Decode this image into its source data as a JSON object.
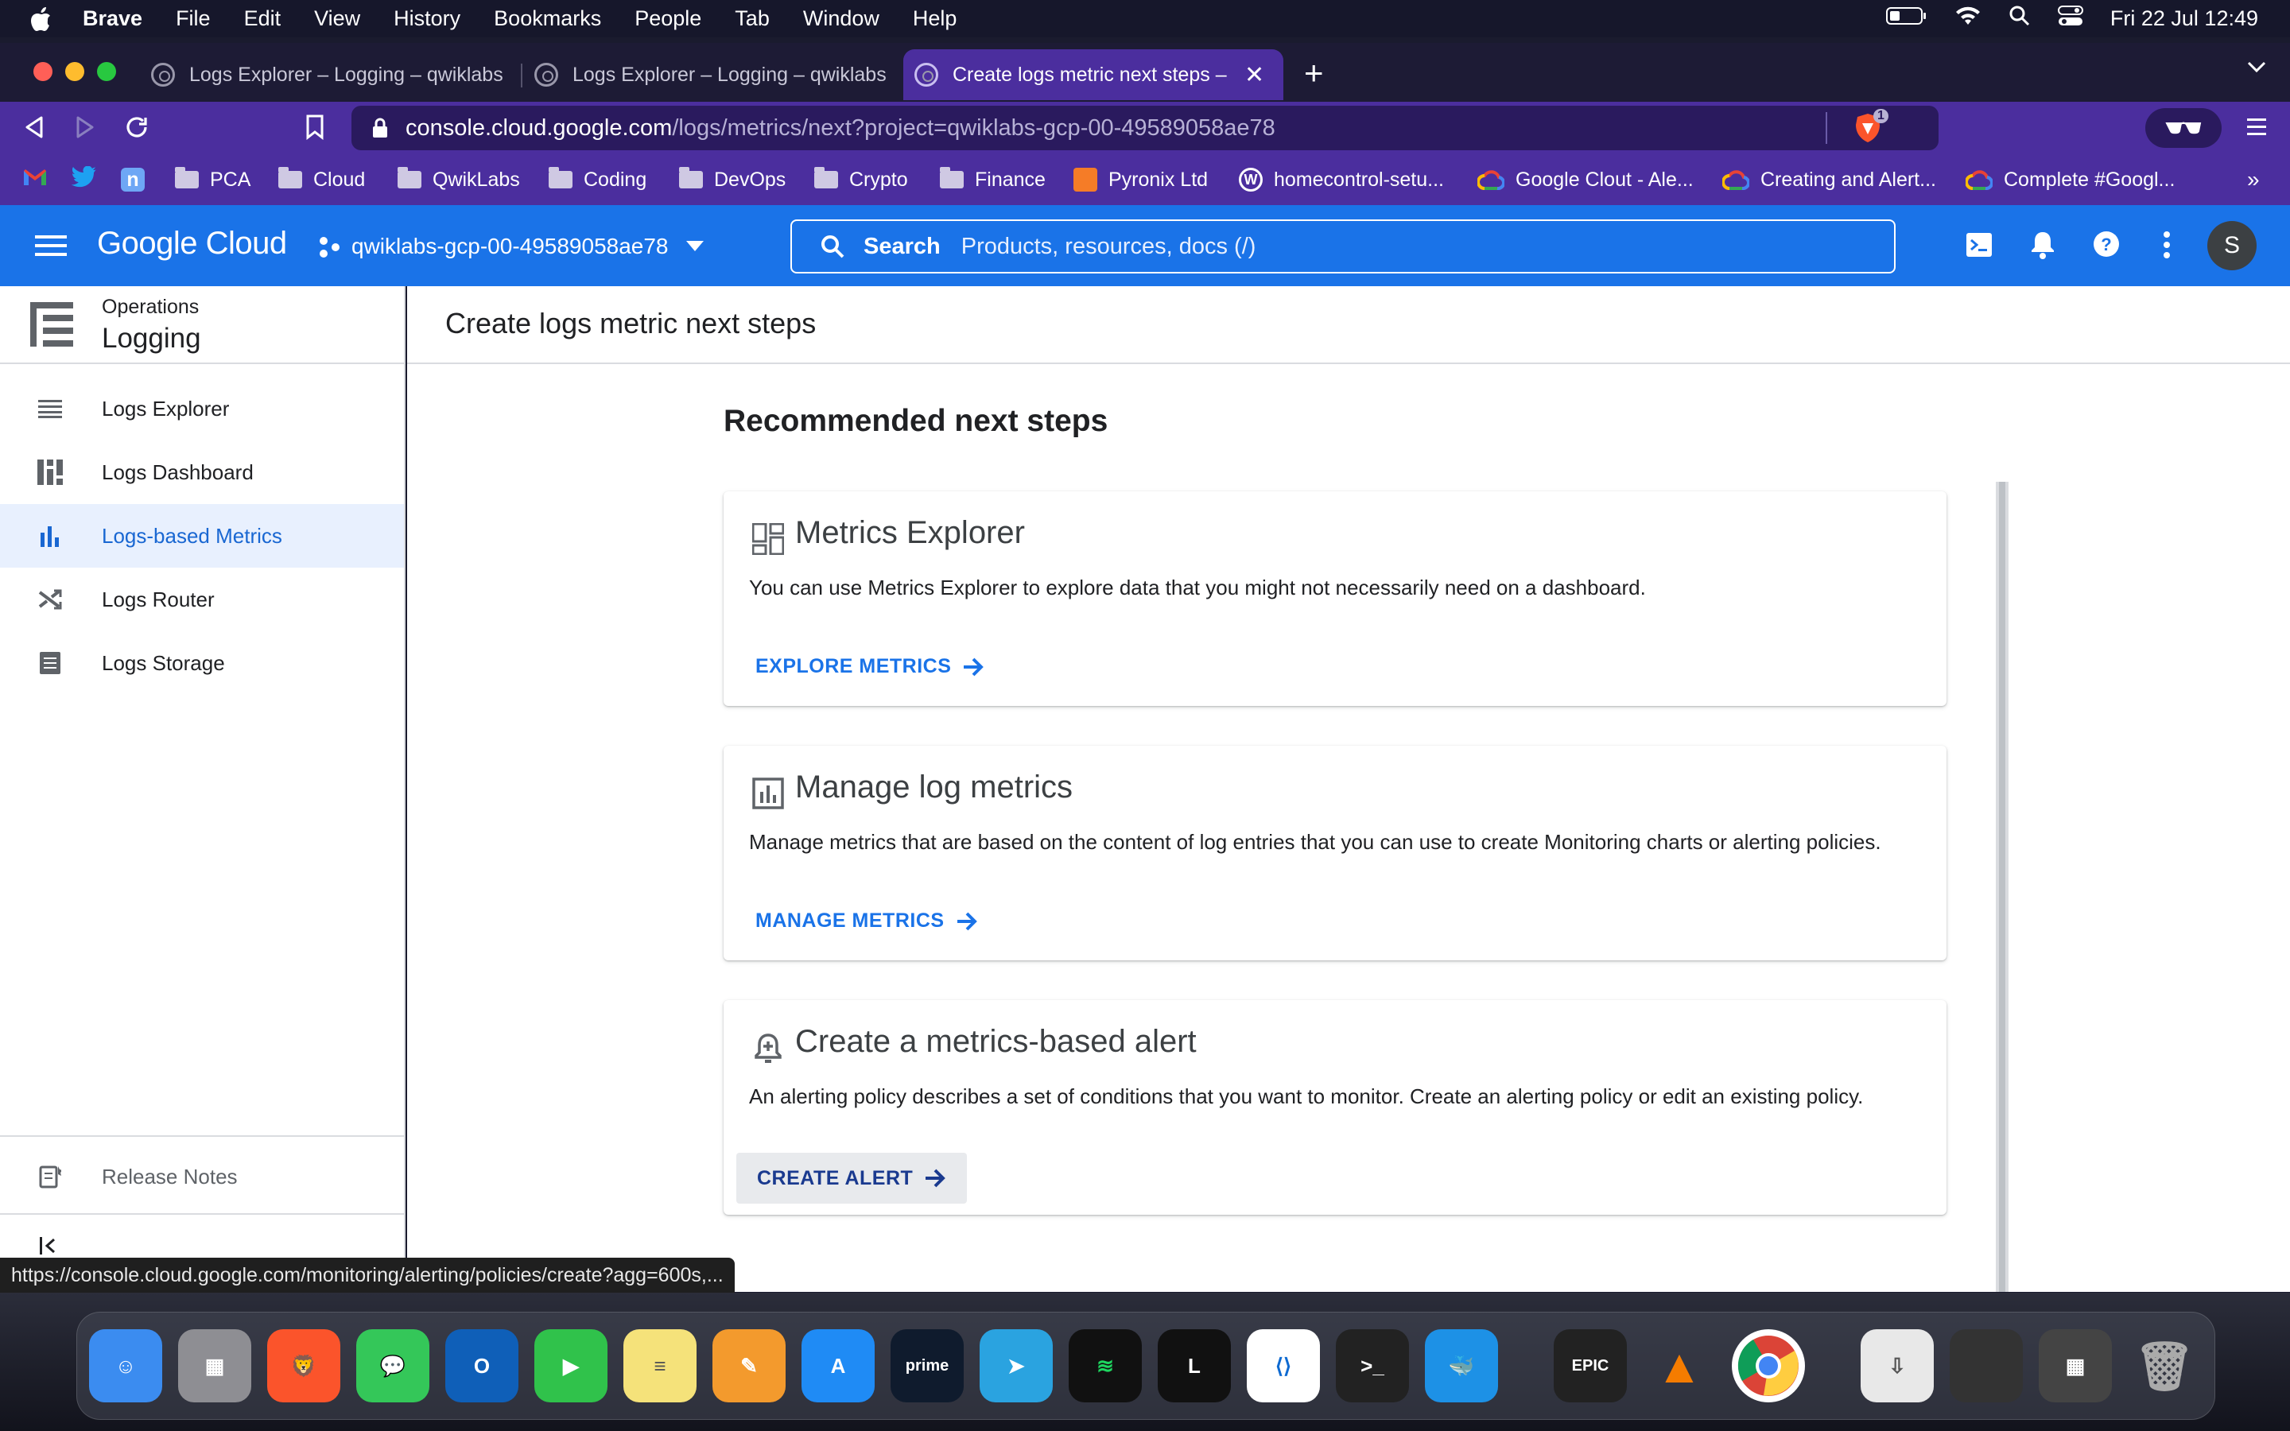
{
  "menubar": {
    "app": "Brave",
    "items": [
      "File",
      "Edit",
      "View",
      "History",
      "Bookmarks",
      "People",
      "Tab",
      "Window",
      "Help"
    ],
    "datetime": "Fri 22 Jul  12:49"
  },
  "tabs": [
    {
      "title": "Logs Explorer – Logging – qwiklabs"
    },
    {
      "title": "Logs Explorer – Logging – qwiklabs"
    },
    {
      "title": "Create logs metric next steps –"
    }
  ],
  "address": {
    "host": "console.cloud.google.com",
    "path": "/logs/metrics/next?project=qwiklabs-gcp-00-49589058ae78",
    "shield_count": "1"
  },
  "bookmarks": [
    {
      "label": "PCA",
      "icon": "folder-icon"
    },
    {
      "label": "Cloud",
      "icon": "folder-icon"
    },
    {
      "label": "QwikLabs",
      "icon": "folder-icon"
    },
    {
      "label": "Coding",
      "icon": "folder-icon"
    },
    {
      "label": "DevOps",
      "icon": "folder-icon"
    },
    {
      "label": "Crypto",
      "icon": "folder-icon"
    },
    {
      "label": "Finance",
      "icon": "folder-icon"
    },
    {
      "label": "Pyronix Ltd",
      "icon": "pyronix-icon"
    },
    {
      "label": "homecontrol-setu...",
      "icon": "wordpress-icon"
    },
    {
      "label": "Google Clout - Ale...",
      "icon": "gcp-icon"
    },
    {
      "label": "Creating and Alert...",
      "icon": "gcp-icon"
    },
    {
      "label": "Complete #Googl...",
      "icon": "gcp-icon"
    }
  ],
  "gcp": {
    "brand": "Google Cloud",
    "project": "qwiklabs-gcp-00-49589058ae78",
    "search_label": "Search",
    "search_placeholder": "Products, resources, docs (/)",
    "avatar": "S"
  },
  "sidebar": {
    "section": "Operations",
    "product": "Logging",
    "items": [
      {
        "label": "Logs Explorer",
        "icon": "list-icon"
      },
      {
        "label": "Logs Dashboard",
        "icon": "dashboard-icon"
      },
      {
        "label": "Logs-based Metrics",
        "icon": "bar-chart-icon",
        "active": true
      },
      {
        "label": "Logs Router",
        "icon": "shuffle-icon"
      },
      {
        "label": "Logs Storage",
        "icon": "storage-icon"
      }
    ],
    "release_notes": "Release Notes"
  },
  "page": {
    "title": "Create logs metric next steps",
    "section_title": "Recommended next steps",
    "cards": [
      {
        "title": "Metrics Explorer",
        "icon": "dashboard-icon",
        "description": "You can use Metrics Explorer to explore data that you might not necessarily need on a dashboard.",
        "action": "EXPLORE METRICS"
      },
      {
        "title": "Manage log metrics",
        "icon": "chart-box-icon",
        "description": "Manage metrics that are based on the content of log entries that you can use to create Monitoring charts or alerting policies.",
        "action": "MANAGE METRICS"
      },
      {
        "title": "Create a metrics-based alert",
        "icon": "bell-add-icon",
        "description": "An alerting policy describes a set of conditions that you want to monitor. Create an alerting policy or edit an existing policy.",
        "action": "CREATE ALERT"
      }
    ]
  },
  "status_url": "https://console.cloud.google.com/monitoring/alerting/policies/create?agg=600s,...",
  "dock": [
    "Finder",
    "Launchpad",
    "Brave",
    "Messages",
    "Outlook",
    "FaceTime",
    "Notes",
    "Pages",
    "App Store",
    "Prime Video",
    "Telegram",
    "Spotify",
    "Lightshot",
    "VS Code",
    "Terminal",
    "Docker",
    "Epic Games",
    "VLC",
    "Chrome",
    "Archive Utility",
    "Trash"
  ],
  "colors": {
    "gcp_blue": "#1a73e8",
    "browser_purple": "#4b2e9e",
    "active_nav_bg": "#e8f0fe"
  }
}
